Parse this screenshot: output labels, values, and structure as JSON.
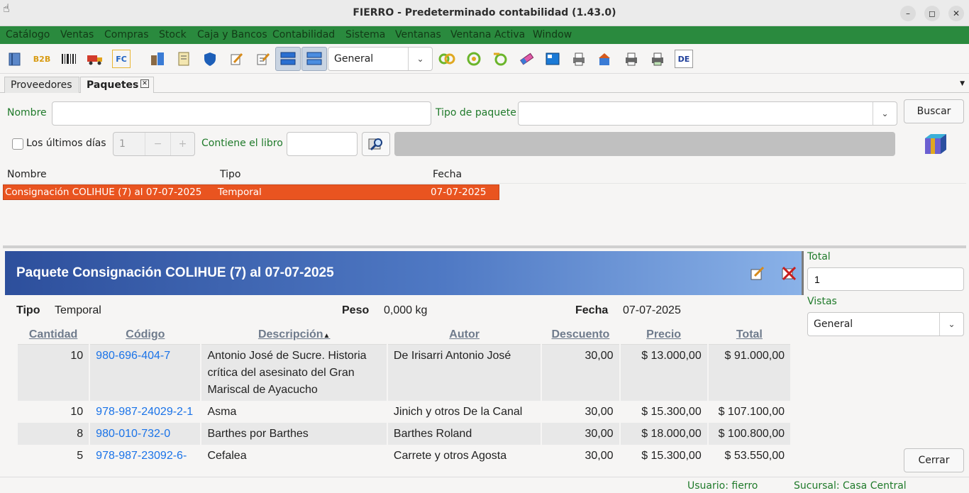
{
  "window": {
    "title": "FIERRO - Predeterminado contabilidad (1.43.0)",
    "minimize_glyph": "–",
    "maximize_glyph": "◻",
    "close_glyph": "✕"
  },
  "menu": [
    "Catálogo",
    "Ventas",
    "Compras",
    "Stock",
    "Caja y Bancos",
    "Contabilidad",
    "Sistema",
    "Ventanas",
    "Ventana Activa",
    "Window"
  ],
  "toolbar": {
    "view_combo_value": "General",
    "b2b_label": "B2B",
    "fc_label": "FC",
    "de_label": "DE"
  },
  "tabs": [
    {
      "label": "Proveedores",
      "active": false
    },
    {
      "label": "Paquetes",
      "active": true,
      "close_glyph": "✕"
    }
  ],
  "filters": {
    "nombre_label": "Nombre",
    "nombre_value": "",
    "tipo_label": "Tipo de paquete",
    "tipo_value": "",
    "buscar_label": "Buscar",
    "ultimos_dias_label": "Los últimos días",
    "ultimos_dias_value": "1",
    "minus_glyph": "−",
    "plus_glyph": "+",
    "contiene_libro_label": "Contiene el libro",
    "contiene_libro_value": ""
  },
  "list": {
    "columns": [
      "Nombre",
      "Tipo",
      "Fecha"
    ],
    "rows": [
      {
        "nombre": "Consignación COLIHUE (7) al 07-07-2025",
        "tipo": "Temporal",
        "fecha": "07-07-2025",
        "selected": true
      }
    ]
  },
  "detail": {
    "title": "Paquete Consignación COLIHUE (7) al 07-07-2025",
    "tipo_label": "Tipo",
    "tipo_value": "Temporal",
    "peso_label": "Peso",
    "peso_value": "0,000 kg",
    "fecha_label": "Fecha",
    "fecha_value": "07-07-2025",
    "columns": [
      "Cantidad",
      "Código",
      "Descripción",
      "Autor",
      "Descuento",
      "Precio",
      "Total"
    ],
    "sort_glyph": "▲",
    "rows": [
      {
        "cantidad": "10",
        "codigo": "980-696-404-7",
        "descripcion": "Antonio José de Sucre. Historia crítica del asesinato del Gran Mariscal de Ayacucho",
        "autor": "De Irisarri Antonio José",
        "descuento": "30,00",
        "precio": "$ 13.000,00",
        "total": "$ 91.000,00"
      },
      {
        "cantidad": "10",
        "codigo": "978-987-24029-2-1",
        "descripcion": "Asma",
        "autor": "Jinich y otros De la Canal",
        "descuento": "30,00",
        "precio": "$ 15.300,00",
        "total": "$ 107.100,00"
      },
      {
        "cantidad": "8",
        "codigo": "980-010-732-0",
        "descripcion": "Barthes por Barthes",
        "autor": "Barthes Roland",
        "descuento": "30,00",
        "precio": "$ 18.000,00",
        "total": "$ 100.800,00"
      },
      {
        "cantidad": "5",
        "codigo": "978-987-23092-6-",
        "descripcion": "Cefalea",
        "autor": "Carrete y otros Agosta",
        "descuento": "30,00",
        "precio": "$ 15.300,00",
        "total": "$ 53.550,00"
      }
    ]
  },
  "side": {
    "total_label": "Total",
    "total_value": "1",
    "vistas_label": "Vistas",
    "vistas_value": "General",
    "cerrar_label": "Cerrar"
  },
  "status": {
    "usuario": "Usuario: fierro",
    "sucursal": "Sucursal: Casa Central"
  },
  "colors": {
    "accent_green": "#2a8a3e",
    "selection": "#e95420",
    "banner": "#2d4f9c",
    "link": "#1a73e8"
  }
}
